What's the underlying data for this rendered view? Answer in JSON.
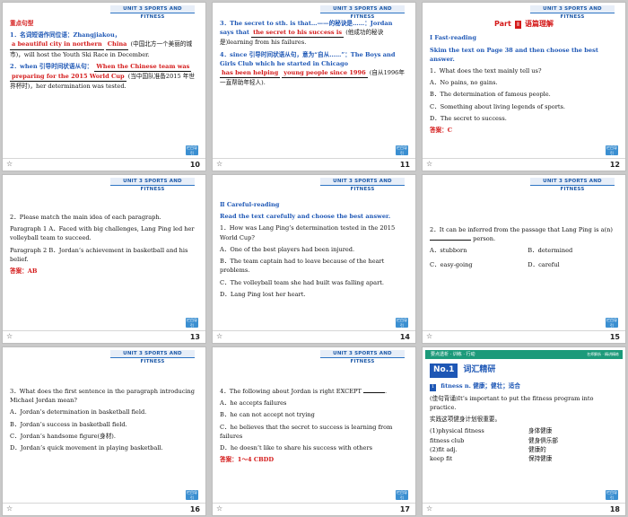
{
  "header_label": "UNIT 3  SPORTS AND FITNESS",
  "back_label": "栏目导引",
  "slides": [
    {
      "page": "10",
      "title": "重点句型",
      "l1": "1．名词短语作同位语：Zhangjiakou，",
      "a1": "a beautiful city in northern",
      "a2": "China",
      "l2": "(中国北方一个美丽的城市)，will host the Youth Ski Race in December.",
      "l3": "2．when 引导时间状语从句：",
      "a3": "When the Chinese team was",
      "a4": "preparing for the 2015 World Cup",
      "l4": "(当中国队准备2015 年世界杯时)，her determination was tested."
    },
    {
      "page": "11",
      "l1": "3．The secret to sth. is that…——的秘诀是……：Jordan says that",
      "a1": "the secret to his success is",
      "l2": "(他成功的秘诀是)learning from his failures.",
      "l3": "4．since 引导时间状语从句，意为“自从……”：The Boys and Girls Club which he started in Chicago",
      "a2": "has been helping",
      "a3": "young people since 1996",
      "l4": "(自从1996年一直帮助年轻人)."
    },
    {
      "page": "12",
      "part_label": "Part",
      "part_num": "Ⅱ",
      "part_title": "语篇理解",
      "section": "Ⅰ  Fast-reading",
      "instruction": "Skim the text on Page 38 and then choose the best answer.",
      "q": "1．What does the text mainly tell us?",
      "opts": [
        "A．No pains, no gains.",
        "B．The determination of famous people.",
        "C．Something about living legends of sports.",
        "D．The secret to success."
      ],
      "answer": "答案：C"
    },
    {
      "page": "13",
      "q": "2．Please match the main idea of each paragraph.",
      "p1": "Paragraph 1  A．Faced with big challenges, Lang Ping led her volleyball team to succeed.",
      "p2": "Paragraph 2  B．Jordan’s achievement in basketball and his belief.",
      "answer": "答案：AB"
    },
    {
      "page": "14",
      "section": "Ⅱ  Careful-reading",
      "instruction": "Read the text carefully and choose the best answer.",
      "q": "1．How was Lang Ping’s determination tested in the 2015 World Cup?",
      "opts": [
        "A．One of the best players had been injured.",
        "B．The team captain had to leave because of the heart problems.",
        "C．The volleyball team she had built was falling apart.",
        "D．Lang Ping lost her heart."
      ]
    },
    {
      "page": "15",
      "q1": "2．It can be inferred from the passage that Lang Ping is a(n)",
      "q2": "person.",
      "opts": [
        "A．stubborn",
        "B．determined",
        "C．easy-going",
        "D．careful"
      ]
    },
    {
      "page": "16",
      "q": "3．What does the first sentence in the paragraph introducing Michael Jordan mean?",
      "opts": [
        "A．Jordan’s determination in basketball field.",
        "B．Jordan’s success in basketball field.",
        "C．Jordan’s handsome figure(身材).",
        "D．Jordan’s quick movement in playing basketball."
      ]
    },
    {
      "page": "17",
      "q": "4．The following about Jordan is right EXCEPT",
      "opts": [
        "A．he accepts failures",
        "B．he can not accept not trying",
        "C．he believes that the secret to success is learning from failures",
        "D．he doesn’t like to share his success with others"
      ],
      "answer": "答案：1～4 CBDD"
    },
    {
      "page": "18",
      "banner": "要点透析 · 训练 · 行动",
      "banner_tail": "名师解析 · 精讲精练",
      "no_label": "No.1",
      "title": "词汇精研",
      "word_num": "1",
      "word": "fitness  n. 健康；健壮；适合",
      "ex1": "(佳句背诵)It’s important to put the fitness program into practice.",
      "ex2": "实践这项健身计划很重要。",
      "pairs": [
        [
          "(1)physical fitness",
          "身体健康"
        ],
        [
          "fitness club",
          "健身俱乐部"
        ],
        [
          "(2)fit adj.",
          "健康的"
        ],
        [
          "keep fit",
          "保持健康"
        ]
      ]
    }
  ]
}
